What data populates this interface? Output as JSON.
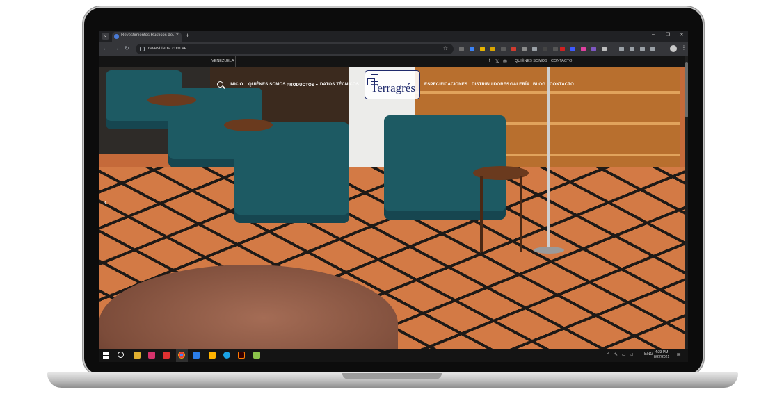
{
  "browser": {
    "tab_title": "Revestimientos Rústicos de Arte Cerámico",
    "url": "revestiterra.com.ve",
    "new_tab_label": "+",
    "window_min": "–",
    "window_max": "❐",
    "window_close": "✕"
  },
  "site": {
    "top_bar": {
      "location": "VENEZUELA",
      "links": [
        "QUIÉNES SOMOS",
        "CONTACTO"
      ]
    },
    "logo_text": "Terragrés",
    "nav_left": [
      "INICIO",
      "QUIÉNES SOMOS",
      "PRODUCTOS ▾",
      "DATOS TÉCNICOS"
    ],
    "nav_right": [
      "ESPECIFICACIONES",
      "DISTRIBUIDORES",
      "GALERÍA",
      "BLOG",
      "CONTACTO"
    ]
  },
  "taskbar": {
    "language": "ENG",
    "time": "4:23 PM",
    "date": "8/27/2021"
  },
  "colors": {
    "chrome_dark": "#202124",
    "chrome_toolbar": "#35363a",
    "logo_blue": "#1f2a6c"
  }
}
